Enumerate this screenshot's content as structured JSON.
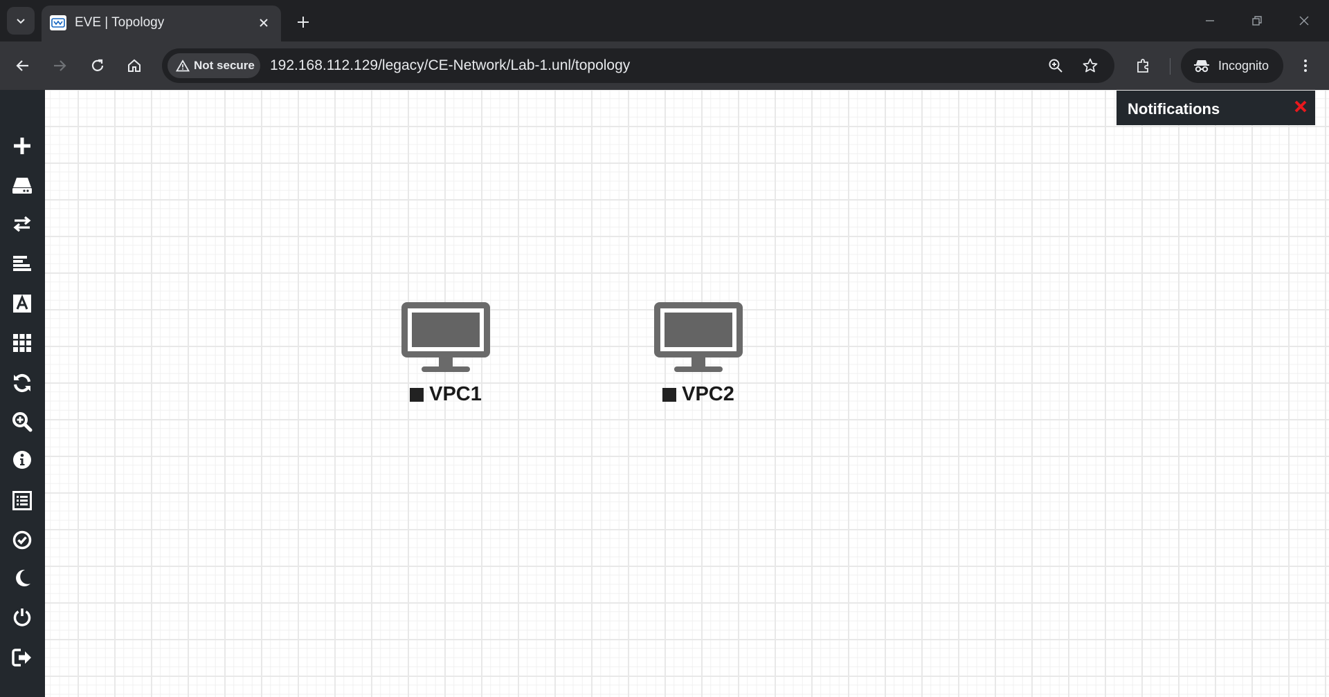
{
  "browser": {
    "tab": {
      "title": "EVE | Topology"
    },
    "security_label": "Not secure",
    "url": "192.168.112.129/legacy/CE-Network/Lab-1.unl/topology",
    "profile_label": "Incognito"
  },
  "sidebar": {
    "items": [
      {
        "icon": "add-icon"
      },
      {
        "icon": "nodes-icon"
      },
      {
        "icon": "networks-icon"
      },
      {
        "icon": "startup-configs-icon"
      },
      {
        "icon": "text-icon"
      },
      {
        "icon": "grid-icon"
      },
      {
        "icon": "refresh-icon"
      },
      {
        "icon": "zoom-icon"
      },
      {
        "icon": "info-icon"
      },
      {
        "icon": "list-icon"
      },
      {
        "icon": "check-icon"
      },
      {
        "icon": "moon-icon"
      },
      {
        "icon": "power-icon"
      },
      {
        "icon": "logout-icon"
      }
    ]
  },
  "topology": {
    "nodes": [
      {
        "name": "VPC1",
        "status": "stopped"
      },
      {
        "name": "VPC2",
        "status": "stopped"
      }
    ]
  },
  "notifications": {
    "title": "Notifications"
  },
  "colors": {
    "sidebar_bg": "#23282d",
    "close_red": "#e8181d"
  }
}
